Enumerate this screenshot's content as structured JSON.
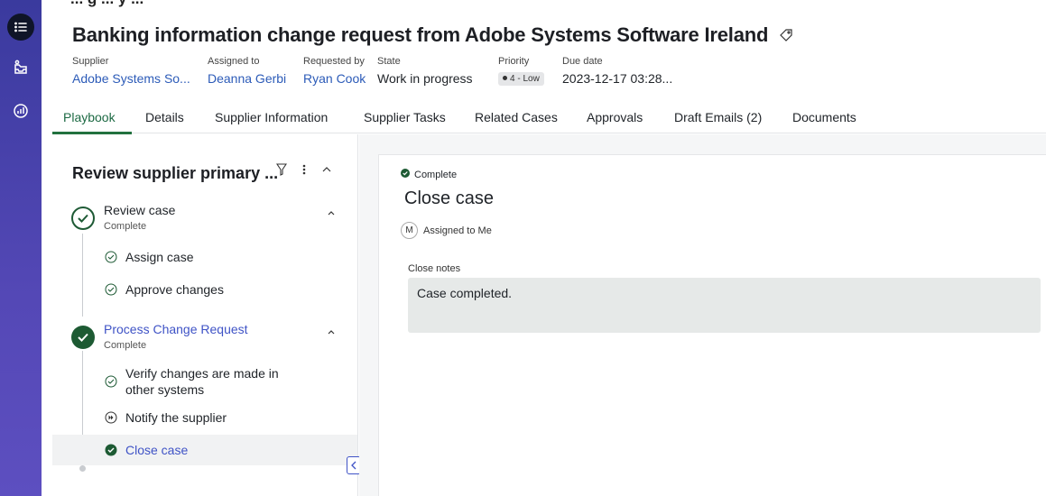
{
  "rail": {
    "items": [
      {
        "name": "menu-icon"
      },
      {
        "name": "inbox-icon"
      },
      {
        "name": "analytics-icon"
      }
    ]
  },
  "header": {
    "clipped_text": "... g ... y ...",
    "title": "Banking information change request from Adobe Systems Software Ireland",
    "fields": {
      "supplier": {
        "label": "Supplier",
        "value": "Adobe Systems So..."
      },
      "assigned_to": {
        "label": "Assigned to",
        "value": "Deanna Gerbi"
      },
      "requested_by": {
        "label": "Requested by",
        "value": "Ryan Cook"
      },
      "state": {
        "label": "State",
        "value": "Work in progress"
      },
      "priority": {
        "label": "Priority",
        "value": "4 - Low"
      },
      "due_date": {
        "label": "Due date",
        "value": "2023-12-17 03:28..."
      }
    }
  },
  "tabs": [
    {
      "label": "Playbook",
      "active": true
    },
    {
      "label": "Details"
    },
    {
      "label": "Supplier Information"
    },
    {
      "label": "Supplier Tasks"
    },
    {
      "label": "Related Cases"
    },
    {
      "label": "Approvals"
    },
    {
      "label": "Draft Emails (2)"
    },
    {
      "label": "Documents"
    }
  ],
  "playbook": {
    "heading": "Review supplier primary ...",
    "stages": [
      {
        "title": "Review case",
        "status": "Complete",
        "tasks": [
          {
            "label": "Assign case",
            "icon": "check-circle-outline-icon"
          },
          {
            "label": "Approve changes",
            "icon": "check-circle-outline-icon"
          }
        ]
      },
      {
        "title": "Process Change Request",
        "status": "Complete",
        "tasks": [
          {
            "label": "Verify changes are made in",
            "label2": "other systems",
            "icon": "check-circle-outline-icon"
          },
          {
            "label": "Notify the supplier",
            "icon": "skip-circle-icon"
          },
          {
            "label": "Close case",
            "icon": "check-circle-filled-icon",
            "selected": true
          }
        ]
      }
    ]
  },
  "detail": {
    "status": "Complete",
    "title": "Close case",
    "avatar_initial": "M",
    "assignee": "Assigned to Me",
    "notes_label": "Close notes",
    "notes_value": "Case completed."
  },
  "colors": {
    "rail": "#4a45b0",
    "accent_green": "#1d5a33",
    "link_blue": "#2c5bb8",
    "task_link": "#3f53c6"
  }
}
